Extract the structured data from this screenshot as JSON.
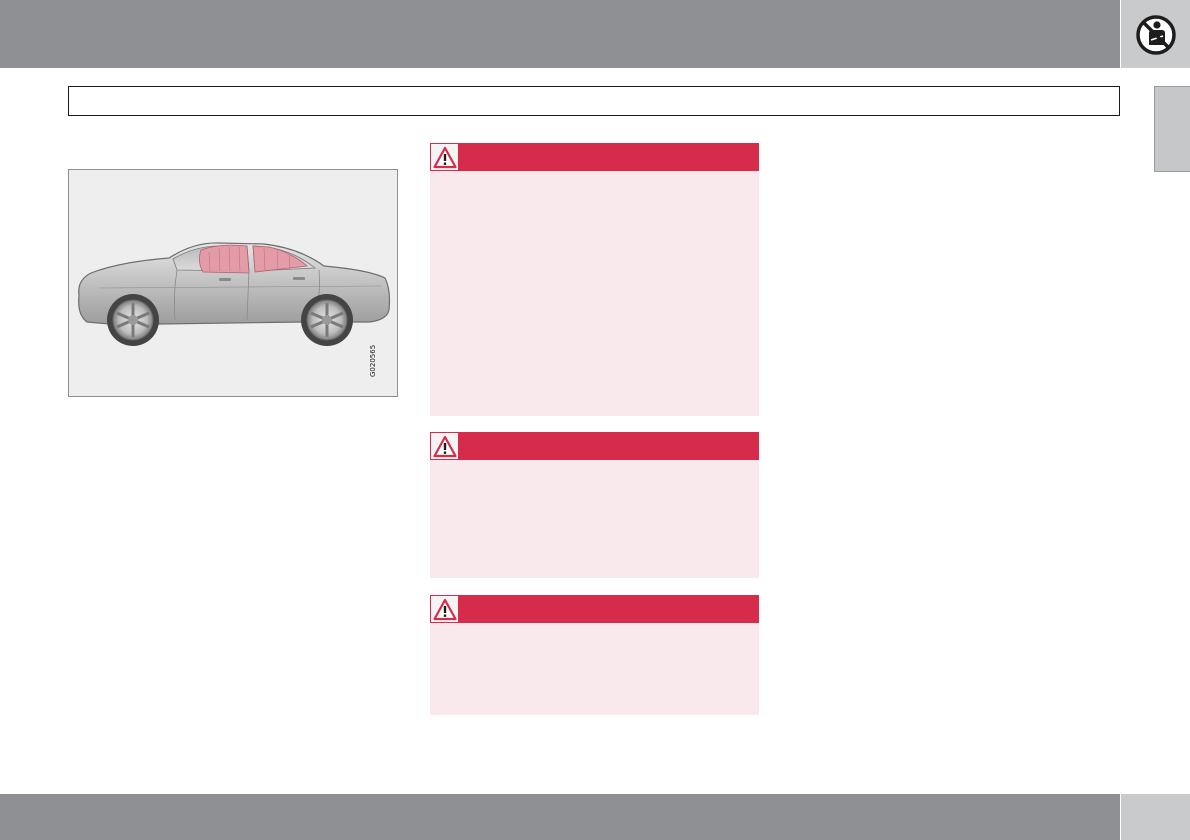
{
  "header": {
    "corner_icon": "no-child-seat-airbag-icon"
  },
  "section_bar": {
    "title": ""
  },
  "figure": {
    "code": "G020565",
    "image": "car-side-curtain-airbag-illustration",
    "airbag_color": "#e59aa6"
  },
  "warnings": [
    {
      "icon": "warning-triangle-icon",
      "text": ""
    },
    {
      "icon": "warning-triangle-icon",
      "text": ""
    },
    {
      "icon": "warning-triangle-icon",
      "text": ""
    }
  ],
  "colors": {
    "bar_gray": "#8f9094",
    "corner_gray": "#c9cacc",
    "warning_red": "#d72b4b",
    "warning_bg": "#f9e9ec"
  }
}
